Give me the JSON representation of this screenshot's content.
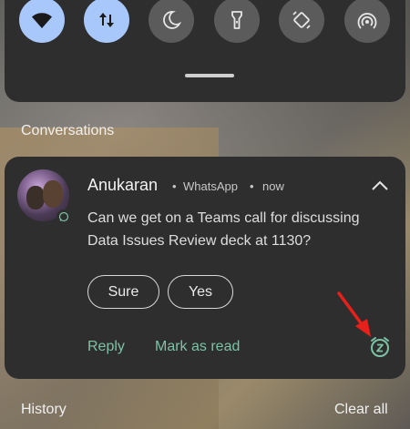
{
  "quick_settings": {
    "tiles": [
      {
        "icon": "wifi-icon",
        "active": true
      },
      {
        "icon": "data-transfer-icon",
        "active": true
      },
      {
        "icon": "moon-icon",
        "active": false
      },
      {
        "icon": "flashlight-icon",
        "active": false
      },
      {
        "icon": "auto-rotate-icon",
        "active": false
      },
      {
        "icon": "hotspot-icon",
        "active": false
      }
    ]
  },
  "sections": {
    "conversations": "Conversations",
    "history": "History",
    "clear_all": "Clear all"
  },
  "notification": {
    "sender": "Anukaran",
    "separator1": "•",
    "app": "WhatsApp",
    "separator2": "•",
    "time": "now",
    "message": "Can we get on a Teams call for discussing Data Issues Review deck at 1130?",
    "chips": [
      "Sure",
      "Yes"
    ],
    "actions": {
      "reply": "Reply",
      "mark_as_read": "Mark as read"
    }
  },
  "colors": {
    "accent_green": "#7cc3a5",
    "tile_active": "#a8c7fa",
    "annotation_arrow": "#e8201a"
  }
}
